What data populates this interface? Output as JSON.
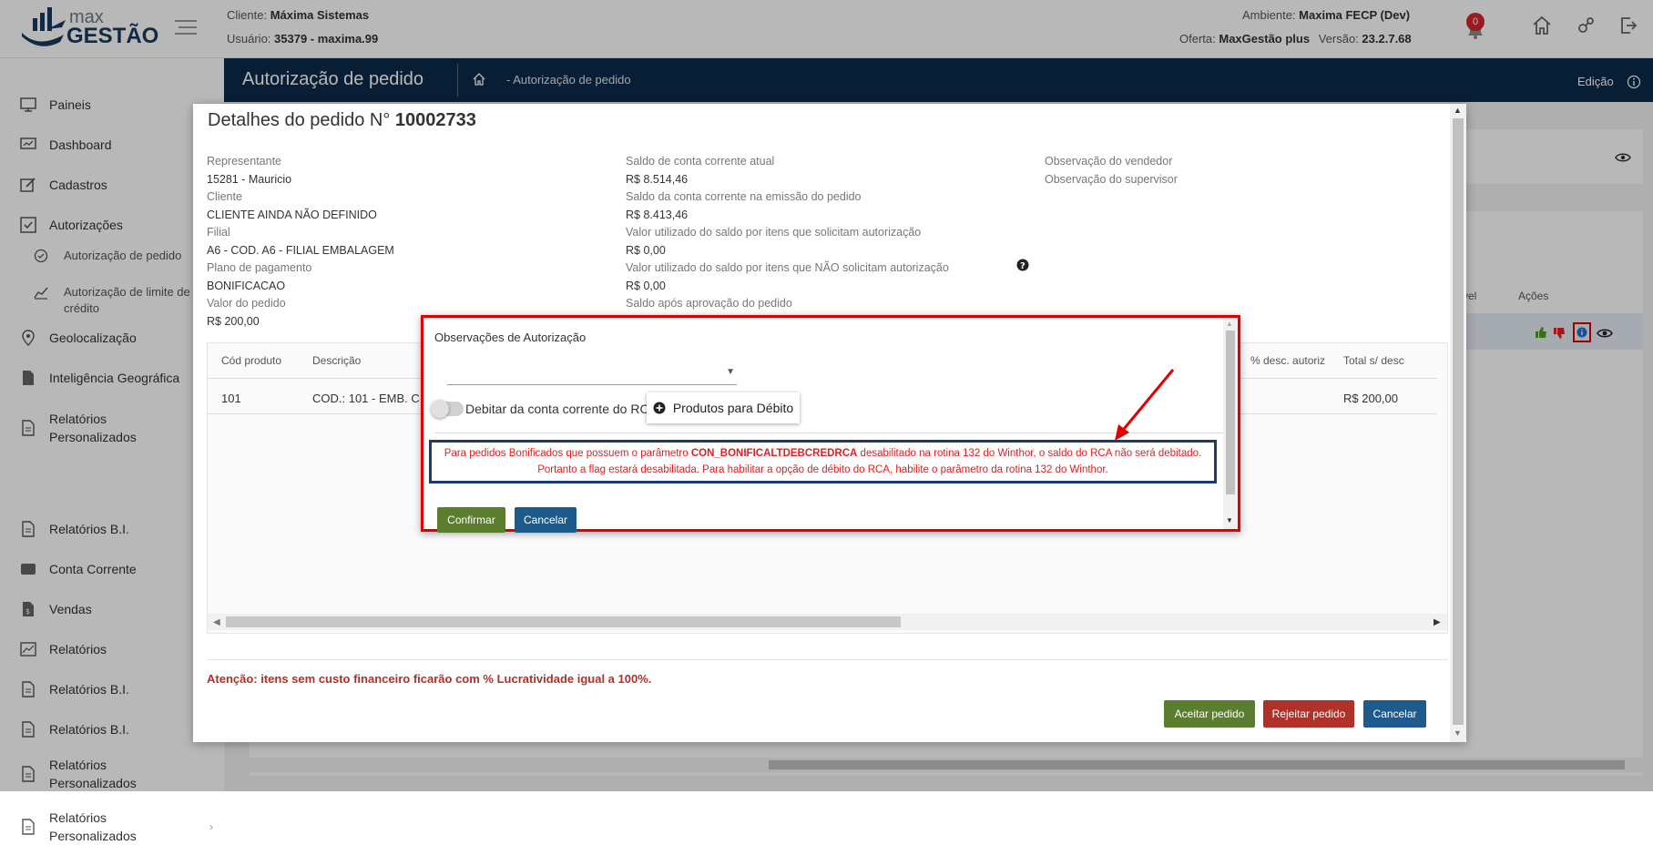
{
  "topbar": {
    "logo_top": "max",
    "logo_bottom": "GESTÃO",
    "cliente_label": "Cliente:",
    "cliente_value": "Máxima Sistemas",
    "usuario_label": "Usuário:",
    "usuario_value": "35379 - maxima.99",
    "ambiente_label": "Ambiente:",
    "ambiente_value": "Maxima FECP (Dev)",
    "oferta_label": "Oferta:",
    "oferta_value": "MaxGestão plus",
    "versao_label": "Versão:",
    "versao_value": "23.2.7.68",
    "notification_count": "0"
  },
  "sidebar": {
    "items": [
      {
        "label": "Paineis"
      },
      {
        "label": "Dashboard"
      },
      {
        "label": "Cadastros"
      },
      {
        "label": "Autorizações"
      },
      {
        "label": "Autorização de pedido"
      },
      {
        "label": "Autorização de limite de crédito"
      },
      {
        "label": "Geolocalização"
      },
      {
        "label": "Inteligência Geográfica"
      },
      {
        "label": "Relatórios Personalizados"
      },
      {
        "label": "Relatórios B.I."
      },
      {
        "label": "Conta Corrente"
      },
      {
        "label": "Vendas"
      },
      {
        "label": "Relatórios"
      },
      {
        "label": "Relatórios B.I."
      },
      {
        "label": "Relatórios B.I."
      },
      {
        "label": "Relatórios Personalizados"
      },
      {
        "label": "Relatórios Personalizados"
      }
    ]
  },
  "pageheader": {
    "title": "Autorização de pedido",
    "breadcrumb": "- Autorização de pedido",
    "edit_label": "Edição"
  },
  "background": {
    "col_nivel": "vel",
    "col_acoes": "Ações"
  },
  "modal": {
    "title_prefix": "Detalhes do pedido N°",
    "order_number": "10002733",
    "col1": [
      {
        "label": "Representante",
        "value": "15281 - Mauricio"
      },
      {
        "label": "Cliente",
        "value": "CLIENTE AINDA NÃO DEFINIDO"
      },
      {
        "label": "Filial",
        "value": "A6 - COD. A6 - FILIAL EMBALAGEM"
      },
      {
        "label": "Plano de pagamento",
        "value": "BONIFICACAO"
      },
      {
        "label": "Valor do pedido",
        "value": "R$ 200,00"
      }
    ],
    "col2": [
      {
        "label": "Saldo de conta corrente atual",
        "value": "R$ 8.514,46"
      },
      {
        "label": "Saldo da conta corrente na emissão do pedido",
        "value": "R$ 8.413,46"
      },
      {
        "label": "Valor utilizado do saldo por itens que solicitam autorização",
        "value": "R$ 0,00"
      },
      {
        "label": "Valor utilizado do saldo por itens que NÃO solicitam autorização",
        "value": "R$ 0,00"
      },
      {
        "label": "Saldo após aprovação do pedido",
        "value": ""
      }
    ],
    "col3": [
      {
        "label": "Observação do vendedor"
      },
      {
        "label": "Observação do supervisor"
      }
    ],
    "table": {
      "headers": [
        "Cód produto",
        "Descrição",
        "% desc. autoriz",
        "Total s/ desc"
      ],
      "row": {
        "cod": "101",
        "descricao": "COD.: 101 - EMB. C",
        "total": "R$ 200,00"
      }
    },
    "warning": "Atenção: itens sem custo financeiro ficarão com % Lucratividade igual a 100%.",
    "buttons": {
      "accept": "Aceitar pedido",
      "reject": "Rejeitar pedido",
      "cancel": "Cancelar"
    }
  },
  "dialog": {
    "title": "Observações de Autorização",
    "select_value": "",
    "toggle_label": "Debitar da conta corrente do RCA",
    "produtos_button": "Produtos para Débito",
    "message_part1": "Para pedidos Bonificados que possuem o parâmetro ",
    "message_param": "CON_BONIFICALTDEBCREDRCA",
    "message_part2": " desabilitado na rotina 132 do Winthor, o saldo do RCA não será debitado. Portanto a flag estará desabilitada. Para habilitar a opção de débito do RCA, habilite o parâmetro da rotina 132 do Winthor.",
    "confirm_button": "Confirmar",
    "cancel_button": "Cancelar"
  },
  "colors": {
    "header_bg": "#0c2a4a",
    "brand_blue": "#1b3a5c",
    "accept_green": "#5a7d2e",
    "reject_red": "#b0302a",
    "cancel_blue": "#1e5a8c",
    "highlight_red": "#e00000",
    "message_red": "#e02020"
  }
}
